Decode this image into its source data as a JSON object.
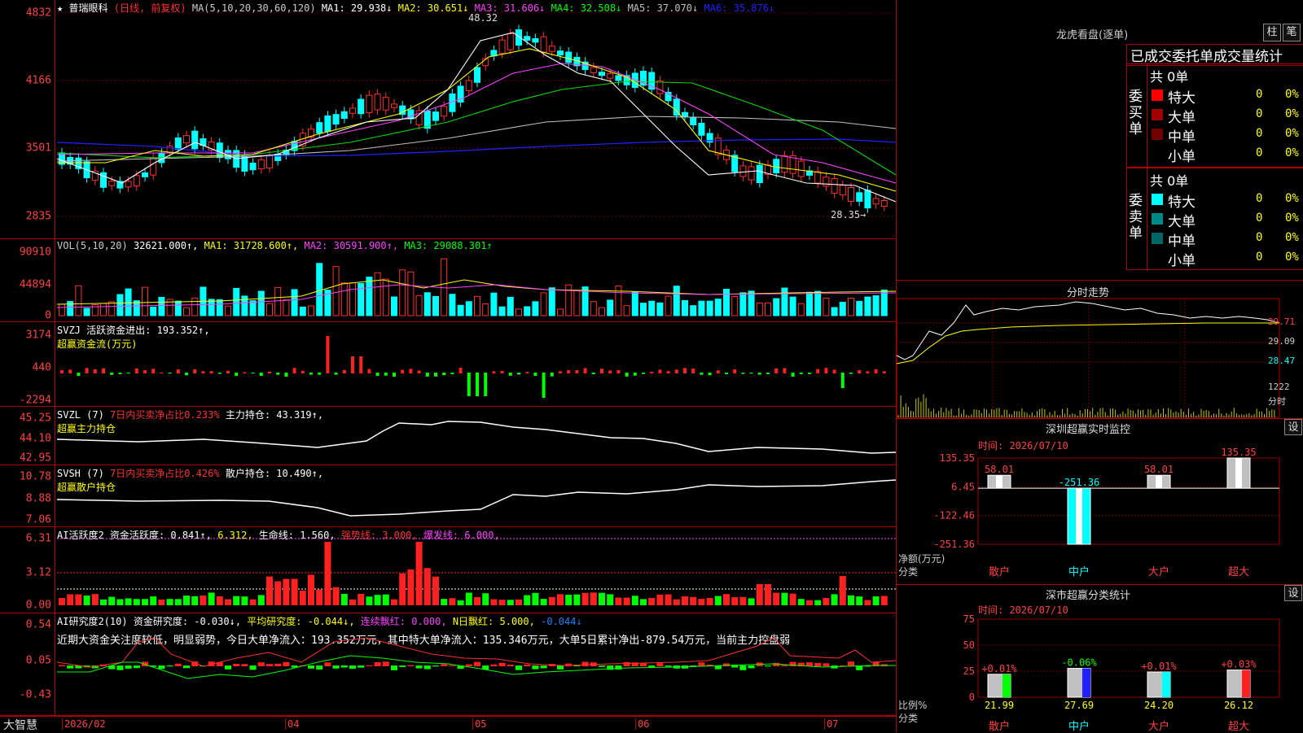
{
  "main": {
    "star": "★",
    "stock": "普瑞眼科",
    "mode": "(日线, 前复权)",
    "ma_params": "MA(5,10,20,30,60,120)",
    "ma_items": [
      {
        "label": "MA1: 29.938↓",
        "color": "#ffffff"
      },
      {
        "label": "MA2: 30.651↓",
        "color": "#ffff00"
      },
      {
        "label": "MA3: 31.606↓",
        "color": "#ff40ff"
      },
      {
        "label": "MA4: 32.508↓",
        "color": "#00ff00"
      },
      {
        "label": "MA5: 37.070↓",
        "color": "#c0c0c0"
      },
      {
        "label": "MA6: 35.876↓",
        "color": "#2020ff"
      }
    ],
    "yticks": [
      "4832",
      "4166",
      "3501",
      "2835"
    ],
    "high_label": "48.32",
    "low_label": "28.35→"
  },
  "vol": {
    "title": "VOL(5,10,20)",
    "v": "32621.000↑,",
    "ma1": "MA1: 31728.600↑,",
    "ma2": "MA2: 30591.900↑,",
    "ma3": "MA3: 29088.301↑",
    "yticks": [
      "90910",
      "44894",
      "0"
    ]
  },
  "svzj": {
    "title": "SVZJ  活跃资金进出: 193.352↑,",
    "sub": "超赢资金流(万元)",
    "yticks": [
      "3174",
      "440",
      "-2294"
    ]
  },
  "svzl": {
    "t1": "SVZL (7)",
    "t2": "7日内买卖净占比0.233%",
    "t3": "主力持仓: 43.319↑,",
    "sub": "超赢主力持仓",
    "yticks": [
      "45.25",
      "44.10",
      "42.95"
    ]
  },
  "svsh": {
    "t1": "SVSH (7)",
    "t2": "7日内买卖净占比0.426%",
    "t3": "散户持仓: 10.490↑,",
    "sub": "超赢散户持仓",
    "yticks": [
      "10.78",
      "8.88",
      "7.06"
    ]
  },
  "ai2": {
    "t1": "AI活跃度2",
    "t2": "资金活跃度: 0.841↑,",
    "t3": "6.312,",
    "t4": "生命线: 1.560,",
    "t5": "强势线: 3.000,",
    "t6": "爆发线: 6.000,",
    "yticks": [
      "6.31",
      "3.12",
      "0.00"
    ]
  },
  "ai3": {
    "t1": "AI研究度2(10)",
    "t2": "资金研究度: -0.030↓,",
    "t3": "平均研究度: -0.044↓,",
    "t4": "连续飘红: 0.000,",
    "t5": "N日飘红: 5.000,",
    "t6": "-0.044↓",
    "comment": "近期大资金关注度较低，明显弱势，今日大单净流入：193.352万元，其中特大单净流入：135.346万元，大单5日累计净出-879.54万元，当前主力控盘弱",
    "yticks": [
      "0.54",
      "0.05",
      "-0.43"
    ]
  },
  "xaxis": {
    "brand": "大智慧",
    "labels": [
      "2026/02",
      "04",
      "05",
      "06",
      "07"
    ]
  },
  "dragon": {
    "title": "龙虎看盘(逐单)",
    "btn1": "柱",
    "btn2": "笔",
    "header": "已成交委托单成交量统计",
    "buy": {
      "side": "委买单",
      "total": "共 0单",
      "rows": [
        {
          "name": "特大",
          "color": "#ff0000",
          "v": "0",
          "p": "0%"
        },
        {
          "name": "大单",
          "color": "#a00000",
          "v": "0",
          "p": "0%"
        },
        {
          "name": "中单",
          "color": "#700000",
          "v": "0",
          "p": "0%"
        },
        {
          "name": "小单",
          "color": "#000000",
          "v": "0",
          "p": "0%"
        }
      ]
    },
    "sell": {
      "side": "委卖单",
      "total": "共 0单",
      "rows": [
        {
          "name": "特大",
          "color": "#00ffff",
          "v": "0",
          "p": "0%"
        },
        {
          "name": "大单",
          "color": "#008888",
          "v": "0",
          "p": "0%"
        },
        {
          "name": "中单",
          "color": "#006666",
          "v": "0",
          "p": "0%"
        },
        {
          "name": "小单",
          "color": "#000000",
          "v": "0",
          "p": "0%"
        }
      ]
    }
  },
  "intraday": {
    "title": "分时走势",
    "prices": [
      "29.71",
      "29.09",
      "28.47"
    ],
    "vol": "1222",
    "vol_unit": "分时"
  },
  "monitor": {
    "title": "深圳超赢实时监控",
    "btn": "设",
    "time": "时间: 2026/07/10",
    "yticks": [
      "135.35",
      "6.45",
      "-122.46",
      "-251.36"
    ],
    "ylabel": "净额(万元)",
    "xlabel": "分类",
    "cats": [
      {
        "name": "散户",
        "value": 58.01,
        "label": "58.01"
      },
      {
        "name": "中户",
        "value": -251.36,
        "label": "-251.36"
      },
      {
        "name": "大户",
        "value": 58.01,
        "label": "58.01"
      },
      {
        "name": "超大",
        "value": 135.35,
        "label": "135.35"
      }
    ]
  },
  "classify": {
    "title": "深市超赢分类统计",
    "btn": "设",
    "time": "时间: 2026/07/10",
    "yticks": [
      "75",
      "50",
      "25",
      "0"
    ],
    "ylabel": "比例%",
    "xlabel": "分类",
    "cats": [
      {
        "name": "散户",
        "value": 21.99,
        "label": "21.99",
        "delta": "+0.01%",
        "color": "#00ff00"
      },
      {
        "name": "中户",
        "value": 27.69,
        "label": "27.69",
        "delta": "-0.06%",
        "color": "#2020ff"
      },
      {
        "name": "大户",
        "value": 24.2,
        "label": "24.20",
        "delta": "+0.01%",
        "color": "#00ffff"
      },
      {
        "name": "超大",
        "value": 26.12,
        "label": "26.12",
        "delta": "+0.03%",
        "color": "#ff2020"
      }
    ]
  }
}
